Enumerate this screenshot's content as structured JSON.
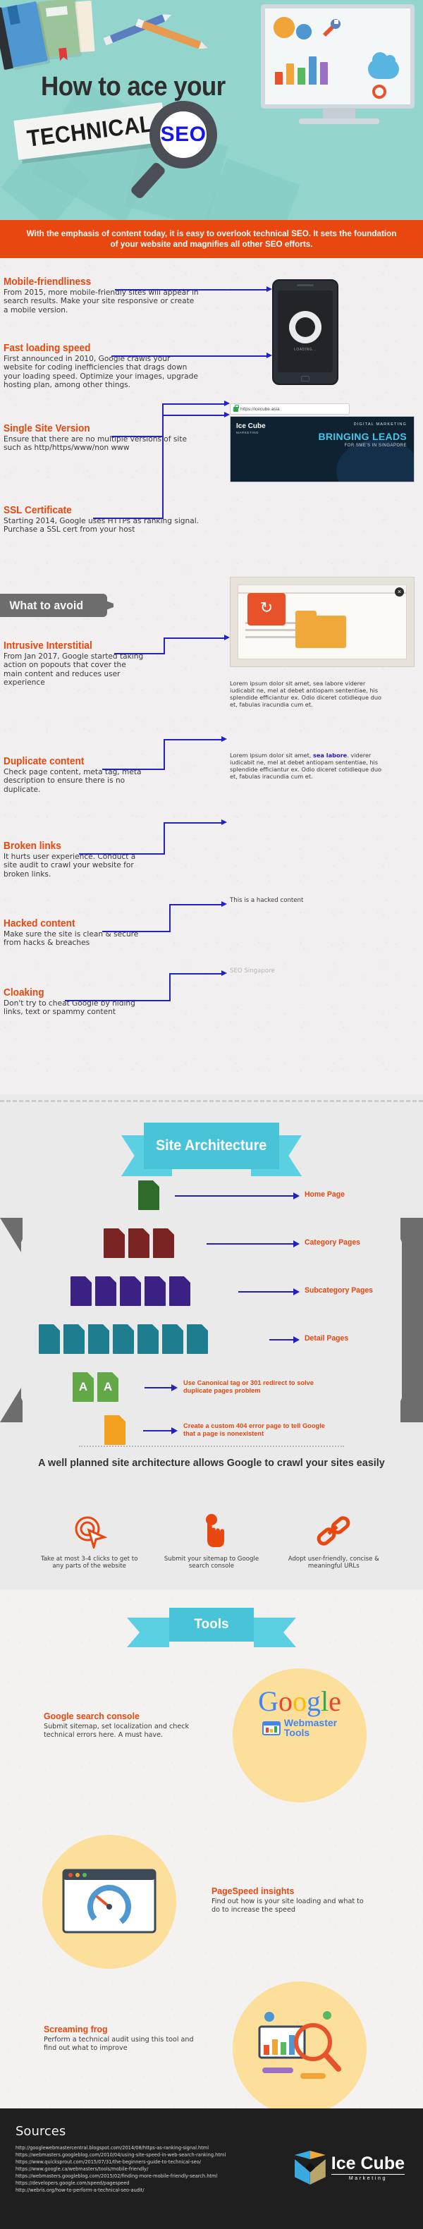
{
  "hero": {
    "title_line": "How to ace your",
    "banner_word": "TECHNICAL",
    "magnifier_word": "SEO"
  },
  "intro_banner": {
    "text": "With the emphasis of content today, it is easy to overlook technical SEO. It sets the foundation of your website and magnifies all other SEO efforts."
  },
  "checklist": [
    {
      "title": "Mobile-friendliness",
      "body": "From 2015, more mobile-friendly sites will appear in search results. Make your site responsive or create a mobile version."
    },
    {
      "title": "Fast loading speed",
      "body": "First announced in 2010, Google crawls your website for coding inefficiencies that drags down your loading speed. Optimize your images,  upgrade hosting plan, among other things."
    },
    {
      "title": "Single Site Version",
      "body": "Ensure that there are no multiple versions of site such as http/https/www/non www"
    },
    {
      "title": "SSL Certificate",
      "body": "Starting 2014, Google uses HTTPs as ranking signal. Purchase a SSL cert from your host"
    }
  ],
  "avoid_tab_label": "What to avoid",
  "avoid": [
    {
      "title": "Intrusive Interstitial",
      "body": "From Jan 2017, Google started taking action on popouts that cover the main content and reduces user experience"
    },
    {
      "title": "Duplicate content",
      "body": "Check page content, meta tag, meta description to ensure there is no duplicate."
    },
    {
      "title": "Broken links",
      "body": "It hurts user experience. Conduct a site audit to crawl your website for broken links."
    },
    {
      "title": "Hacked content",
      "body": "Make sure the site is clean & secure from hacks & breaches"
    },
    {
      "title": "Cloaking",
      "body": "Don't try to cheat Google by hiding links, text or spammy content"
    }
  ],
  "right_visuals": {
    "phone_loading_label": "LOADING...",
    "url_text": "https://icecube.asia",
    "site_brand": "Ice Cube",
    "site_brand_sub": "MARKETING",
    "site_kicker": "DIGITAL MARKETING",
    "site_headline": "BRINGING LEADS",
    "site_subline": "FOR SME'S IN SINGAPORE",
    "popup_close": "×",
    "lorem_1": "Lorem ipsum dolor sit amet, sea labore viderer iudicabit ne, mel at debet antiopam sententiae, his splendide efficiantur ex. Odio diceret cotidieque duo et, fabulas iracundia cum et.",
    "lorem_2_pre": "Lorem ipsum dolor sit amet, ",
    "lorem_2_link": "sea labore",
    "lorem_2_post": ".  viderer iudicabit ne, mel at debet antiopam sententiae, his splendide efficiantur ex. Odio diceret cotidieque duo et, fabulas iracundia cum et.",
    "hacked_note": "This is a hacked content",
    "cloaking_note": "SEO Singapore"
  },
  "architecture": {
    "ribbon_title": "Site Architecture",
    "levels": [
      {
        "label": "Home Page",
        "count": 1,
        "color": "#2f6b2a"
      },
      {
        "label": "Category Pages",
        "count": 3,
        "color": "#7b2424"
      },
      {
        "label": "Subcategory Pages",
        "count": 5,
        "color": "#3b2183"
      },
      {
        "label": "Detail Pages",
        "count": 7,
        "color": "#1e7d8f"
      }
    ],
    "canonical_note": "Use Canonical tag or 301 redirect to solve duplicate pages problem",
    "canonical_letter": "A",
    "canonical_color": "#63a846",
    "error_note": "Create a custom 404 error page to tell Google that a page is nonexistent",
    "error_color": "#f2a01e",
    "headline": "A well planned site architecture allows Google to crawl your sites easily",
    "tips": [
      {
        "icon": "click-cursor-icon",
        "text": "Take at most 3-4 clicks to get to any parts of the website"
      },
      {
        "icon": "tap-finger-icon",
        "text": "Submit your sitemap to Google search console"
      },
      {
        "icon": "chain-link-icon",
        "text": "Adopt user-friendly, concise & meaningful URLs"
      }
    ]
  },
  "tools": {
    "ribbon_title": "Tools",
    "items": [
      {
        "title": "Google search console",
        "body": "Submit sitemap, set localization and check technical errors here. A must have.",
        "graphic": "google-webmaster-tools-logo",
        "graphic_text_1": "Google",
        "graphic_text_2": "Webmaster",
        "graphic_text_3": "Tools"
      },
      {
        "title": "PageSpeed insights",
        "body": "Find out how is your site loading and what to do to increase the speed",
        "graphic": "speed-gauge-browser-icon"
      },
      {
        "title": "Screaming frog",
        "body": "Perform a technical audit using this tool and find out what to improve",
        "graphic": "magnifier-analytics-icon"
      }
    ]
  },
  "footer": {
    "heading": "Sources",
    "links": [
      "http://googlewebmastercentral.blogspot.com/2014/08/https-as-ranking-signal.html",
      "https://webmasters.googleblog.com/2010/04/using-site-speed-in-web-search-ranking.html",
      "https://www.quicksprout.com/2015/07/31/the-beginners-guide-to-technical-seo/",
      "https://www.google.ca/webmasters/tools/mobile-friendly/",
      "https://webmasters.googleblog.com/2015/02/finding-more-mobile-friendly-search.html",
      "https://developers.google.com/speed/pagespeed",
      "http://webris.org/how-to-perform-a-technical-seo-audit/"
    ],
    "logo_name": "Ice Cube",
    "logo_tagline": "Marketing"
  },
  "colors": {
    "accent_orange": "#e8470f",
    "link_blue": "#2222c4",
    "teal": "#49c3d8",
    "hero_bg": "#93d4cd",
    "dark": "#1f1f1f"
  }
}
